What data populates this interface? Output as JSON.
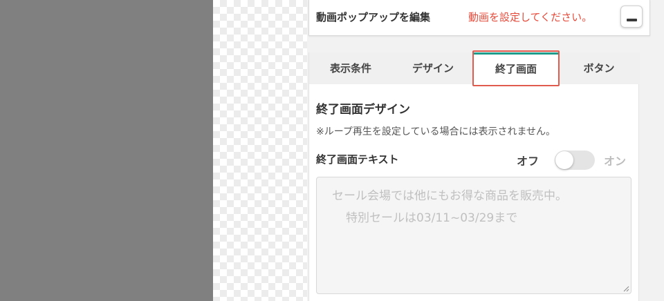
{
  "header": {
    "title": "動画ポップアップを編集",
    "warning": "動画を設定してください。"
  },
  "tabs": [
    {
      "label": "表示条件",
      "active": false
    },
    {
      "label": "デザイン",
      "active": false
    },
    {
      "label": "終了画面",
      "active": true
    },
    {
      "label": "ボタン",
      "active": false
    }
  ],
  "section": {
    "title": "終了画面デザイン",
    "note": "※ループ再生を設定している場合には表示されません。"
  },
  "end_screen_text": {
    "label": "終了画面テキスト",
    "toggle_off_label": "オフ",
    "toggle_on_label": "オン",
    "toggle_state": "off",
    "placeholder_line1": "セール会場では他にもお得な商品を販売中。",
    "placeholder_line2": "特別セールは03/11~03/29まで"
  },
  "colors": {
    "accent": "#1e9c8c",
    "warning": "#e64c3c",
    "highlight": "#e05a4e"
  }
}
